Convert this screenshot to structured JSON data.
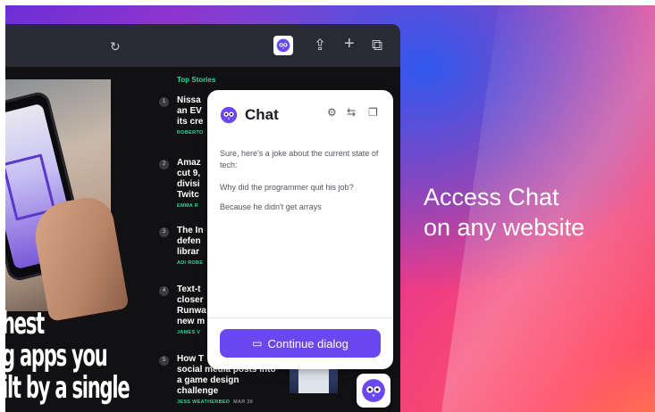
{
  "browser": {
    "toolbar": {
      "icons": [
        "reload-icon",
        "extension-logo-icon",
        "share-icon",
        "new-tab-icon",
        "tabs-icon"
      ]
    },
    "background_headline": [
      "hest",
      "g apps you",
      "ilt by a single"
    ],
    "top_stories": {
      "title": "Top Stories",
      "items": [
        {
          "num": "1",
          "title": "Nissa\nan EV\nits cre",
          "author": "ROBERTO",
          "date": ""
        },
        {
          "num": "2",
          "title": "Amaz\ncut 9,\ndivisi\nTwitc",
          "author": "EMMA R",
          "date": ""
        },
        {
          "num": "3",
          "title": "The In\ndefen\nlibrar",
          "author": "ADI ROBE",
          "date": ""
        },
        {
          "num": "4",
          "title": "Text-t\ncloser\nRunwa\nnew m",
          "author": "JAMES V",
          "date": ""
        },
        {
          "num": "5",
          "title": "How T\nsocial media posts into\na game design\nchallenge",
          "author": "JESS WEATHERBED",
          "date": "MAR 30"
        }
      ]
    }
  },
  "chat": {
    "title": "Chat",
    "header_icons": [
      "gear-icon",
      "translate-icon",
      "copy-icon"
    ],
    "messages": [
      "Sure, here's a joke about the current state of tech:",
      "Why did the programmer quit his job?",
      "Because he didn't get arrays"
    ],
    "continue_label": "Continue dialog"
  },
  "tagline": {
    "line1": "Access Chat",
    "line2": "on any website"
  },
  "colors": {
    "accent": "#6a47ee",
    "story_green": "#2fd49a",
    "browser_bg": "#111114"
  }
}
